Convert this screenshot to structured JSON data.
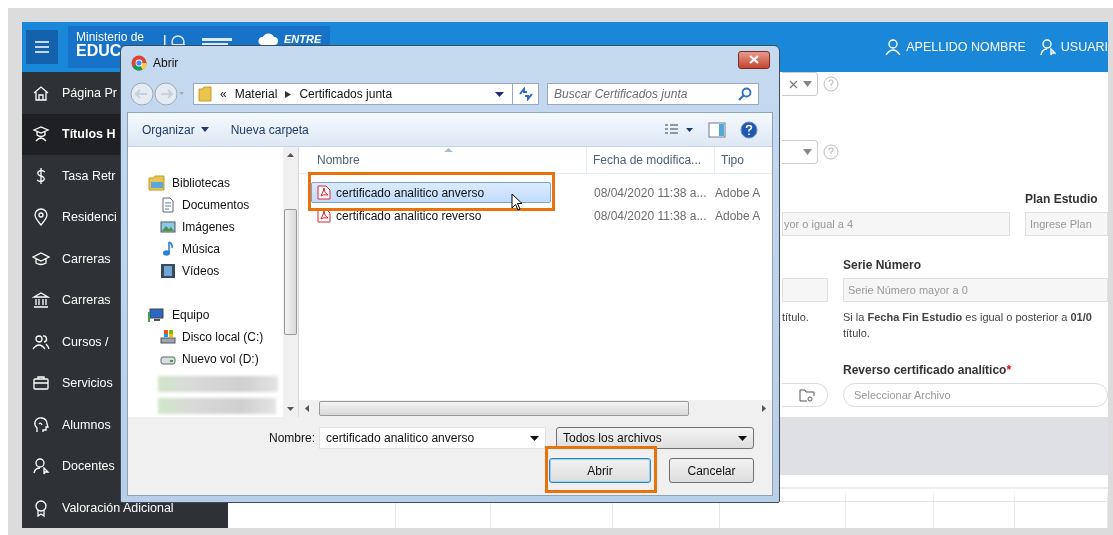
{
  "header": {
    "org_line1": "Ministerio de",
    "org_line2": "EDUC",
    "brand": "ENTRE",
    "user_name": "APELLIDO NOMBRE",
    "user_account": "USUARI"
  },
  "sidebar": {
    "items": [
      {
        "kind": "home",
        "label": "Página Pr",
        "selected": false
      },
      {
        "kind": "graduate",
        "label": "Títulos H",
        "selected": true
      },
      {
        "kind": "dollar",
        "label": "Tasa Retr",
        "selected": false
      },
      {
        "kind": "pin",
        "label": "Residenci",
        "selected": false
      },
      {
        "kind": "cap",
        "label": "Carreras",
        "selected": false
      },
      {
        "kind": "bank",
        "label": "Carreras",
        "selected": false
      },
      {
        "kind": "people",
        "label": "Cursos /",
        "selected": false
      },
      {
        "kind": "briefcase",
        "label": "Servicios",
        "selected": false
      },
      {
        "kind": "head",
        "label": "Alumnos",
        "selected": false
      },
      {
        "kind": "pointer",
        "label": "Docentes",
        "selected": false
      },
      {
        "kind": "award",
        "label": "Valoración Adicional",
        "selected": false
      }
    ]
  },
  "form": {
    "field_1": {
      "placeholder": "yor o igual a 4"
    },
    "plan_estudio": {
      "label": "Plan Estudio",
      "placeholder": "Ingrese Plan"
    },
    "serie_numero": {
      "label": "Serie Número",
      "placeholder": "Serie Número mayor a 0"
    },
    "hint_1": "título.",
    "hint_2": "Si la **Fecha Fin Estudio** es igual o posterior a **01/0** título.",
    "reverso": {
      "label": "Reverso certificado analítico",
      "required_mark": "*",
      "placeholder": "Seleccionar Archivo"
    }
  },
  "dialog": {
    "title": "Abrir",
    "path": [
      {
        "label": "«"
      },
      {
        "label": "Material"
      },
      {
        "label": "Certificados junta"
      }
    ],
    "search": {
      "placeholder": "Buscar Certificados junta"
    },
    "toolbar": {
      "organize": "Organizar",
      "new_folder": "Nueva carpeta"
    },
    "nav": [
      {
        "kind": "library",
        "label": "Bibliotecas",
        "children": [
          {
            "kind": "documents",
            "label": "Documentos"
          },
          {
            "kind": "pictures",
            "label": "Imágenes"
          },
          {
            "kind": "music",
            "label": "Música"
          },
          {
            "kind": "videos",
            "label": "Vídeos"
          }
        ]
      },
      {
        "kind": "computer",
        "label": "Equipo",
        "children": [
          {
            "kind": "system-drive",
            "label": "Disco local (C:)"
          },
          {
            "kind": "drive",
            "label": "Nuevo vol (D:)"
          }
        ]
      }
    ],
    "columns": [
      "Nombre",
      "Fecha de modifica...",
      "Tipo"
    ],
    "files": [
      {
        "name": "certificado analitico anverso",
        "date": "08/04/2020 11:38 a...",
        "type": "Adobe A",
        "selected": true
      },
      {
        "name": "certificado analitico reverso",
        "date": "08/04/2020 11:38 a...",
        "type": "Adobe A",
        "selected": false
      }
    ],
    "filename_label": "Nombre:",
    "filename_value": "certificado analitico anverso",
    "filter": "Todos los archivos",
    "buttons": [
      {
        "kind": "primary",
        "label": "Abrir"
      },
      {
        "kind": "secondary",
        "label": "Cancelar"
      }
    ]
  }
}
